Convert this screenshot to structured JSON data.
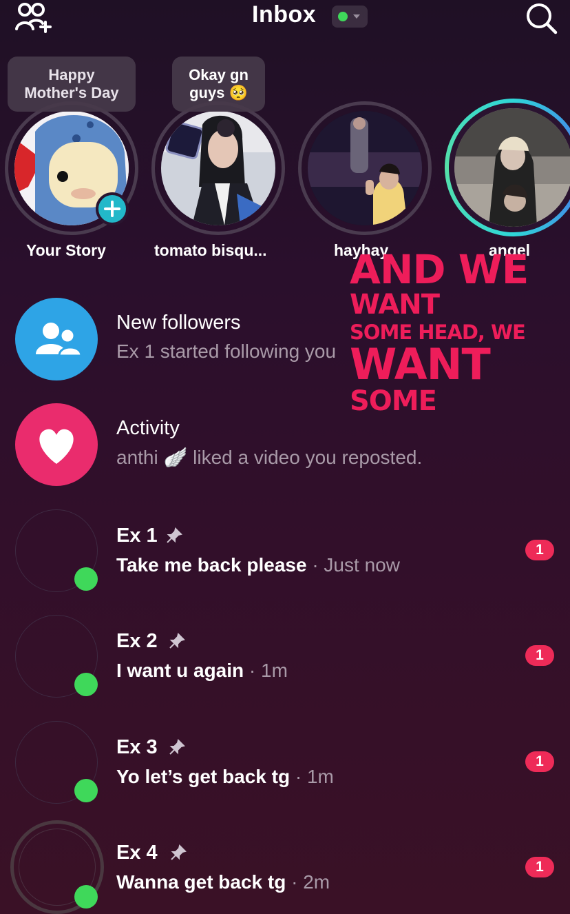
{
  "header": {
    "title": "Inbox",
    "status_color": "#3fd85a",
    "left_icon": "add-friends-icon",
    "right_icon": "search-icon"
  },
  "stories": [
    {
      "name": "Your Story",
      "note": "Happy Mother's Day",
      "note_line1": "Happy",
      "note_line2": "Mother's Day",
      "add_icon": "plus-icon"
    },
    {
      "name": "tomato bisqu...",
      "note": "Okay gn guys 🥺",
      "note_line1": "Okay gn",
      "note_line2": "guys 🥺"
    },
    {
      "name": "hayhay"
    },
    {
      "name": "angel"
    }
  ],
  "sticker": {
    "line1": "AND WE",
    "line2": "WANT",
    "line3": "SOME HEAD, WE",
    "line4": "WANT",
    "line5": "SOME",
    "color": "#ee1d5a"
  },
  "system_rows": [
    {
      "title": "New followers",
      "subtitle": "Ex 1 started following you",
      "icon": "people-icon",
      "color": "#2ea4e6"
    },
    {
      "title": "Activity",
      "subtitle_user": "anthi",
      "subtitle_emoji": "🪽",
      "subtitle_text": "liked a video you reposted.",
      "icon": "heart-icon",
      "color": "#ea2c6d"
    }
  ],
  "chats": [
    {
      "name": "Ex 1",
      "message": "Take me back please",
      "time": "· Just now",
      "unread": "1"
    },
    {
      "name": "Ex 2",
      "message": "I want u again",
      "time": "· 1m",
      "unread": "1"
    },
    {
      "name": "Ex 3",
      "message": "Yo let’s get back tg",
      "time": "· 1m",
      "unread": "1"
    },
    {
      "name": "Ex 4",
      "message": "Wanna get back tg",
      "time": "· 2m",
      "unread": "1"
    }
  ],
  "colors": {
    "online": "#3fd85a",
    "badge": "#ee2b58",
    "story_ring_active_start": "#2fd6d8",
    "story_ring_active_end": "#4b6cf0"
  }
}
